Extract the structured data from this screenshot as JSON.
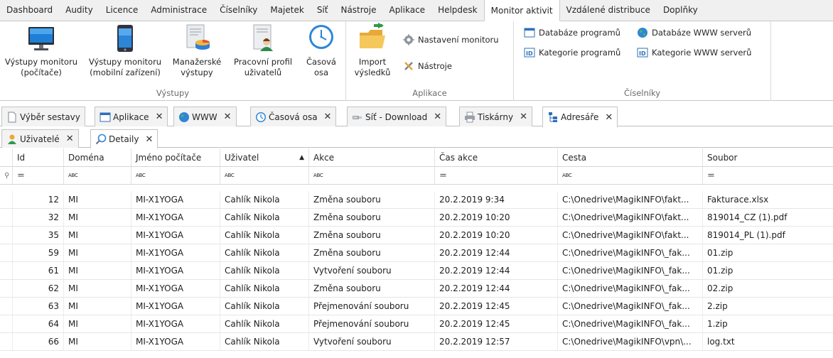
{
  "menu": [
    "Dashboard",
    "Audity",
    "Licence",
    "Administrace",
    "Číselníky",
    "Majetek",
    "Síť",
    "Nástroje",
    "Aplikace",
    "Helpdesk",
    "Monitor aktivit",
    "Vzdálené distribuce",
    "Doplňky"
  ],
  "menu_active": "Monitor aktivit",
  "ribbon": {
    "vystupy": {
      "title": "Výstupy",
      "btn1": [
        "Výstupy monitoru",
        "(počítače)"
      ],
      "btn2": [
        "Výstupy monitoru",
        "(mobilní zařízení)"
      ],
      "btn3": [
        "Manažerské",
        "výstupy"
      ],
      "btn4": [
        "Pracovní profil",
        "uživatelů"
      ],
      "btn5": [
        "Časová",
        "osa"
      ]
    },
    "aplikace": {
      "title": "Aplikace",
      "import": [
        "Import",
        "výsledků"
      ],
      "nastaveni": "Nastavení monitoru",
      "nastroje": "Nástroje"
    },
    "ciselniky": {
      "title": "Číselníky",
      "db_programu": "Databáze programů",
      "kat_programu": "Kategorie programů",
      "db_www": "Databáze WWW serverů",
      "kat_www": "Kategorie WWW serverů"
    }
  },
  "doc_tabs": [
    "Výběr sestavy",
    "Aplikace",
    "WWW",
    "Časová osa",
    "Síť - Download",
    "Tiskárny",
    "Adresáře"
  ],
  "doc_tab_active": "Adresáře",
  "sub_tabs": [
    "Uživatelé",
    "Detaily"
  ],
  "sub_tab_active": "Detaily",
  "grid": {
    "columns": [
      "Id",
      "Doména",
      "Jméno počítače",
      "Uživatel",
      "Akce",
      "Čas akce",
      "Cesta",
      "Soubor"
    ],
    "filter_eq": "=",
    "filter_abc": "ABC",
    "rows": [
      [
        "12",
        "MI",
        "MI-X1YOGA",
        "Cahlík Nikola",
        "Změna souboru",
        "20.2.2019 9:34",
        "C:\\Onedrive\\MagikINFO\\fakt...",
        "Fakturace.xlsx"
      ],
      [
        "32",
        "MI",
        "MI-X1YOGA",
        "Cahlík Nikola",
        "Změna souboru",
        "20.2.2019 10:20",
        "C:\\Onedrive\\MagikINFO\\fakt...",
        "819014_CZ (1).pdf"
      ],
      [
        "35",
        "MI",
        "MI-X1YOGA",
        "Cahlík Nikola",
        "Změna souboru",
        "20.2.2019 10:20",
        "C:\\Onedrive\\MagikINFO\\fakt...",
        "819014_PL (1).pdf"
      ],
      [
        "59",
        "MI",
        "MI-X1YOGA",
        "Cahlík Nikola",
        "Změna souboru",
        "20.2.2019 12:44",
        "C:\\Onedrive\\MagikINFO\\_fak...",
        "01.zip"
      ],
      [
        "61",
        "MI",
        "MI-X1YOGA",
        "Cahlík Nikola",
        "Vytvoření souboru",
        "20.2.2019 12:44",
        "C:\\Onedrive\\MagikINFO\\_fak...",
        "01.zip"
      ],
      [
        "62",
        "MI",
        "MI-X1YOGA",
        "Cahlík Nikola",
        "Změna souboru",
        "20.2.2019 12:44",
        "C:\\Onedrive\\MagikINFO\\_fak...",
        "02.zip"
      ],
      [
        "63",
        "MI",
        "MI-X1YOGA",
        "Cahlík Nikola",
        "Přejmenování souboru",
        "20.2.2019 12:45",
        "C:\\Onedrive\\MagikINFO\\_fak...",
        "2.zip"
      ],
      [
        "64",
        "MI",
        "MI-X1YOGA",
        "Cahlík Nikola",
        "Přejmenování souboru",
        "20.2.2019 12:45",
        "C:\\Onedrive\\MagikINFO\\_fak...",
        "1.zip"
      ],
      [
        "66",
        "MI",
        "MI-X1YOGA",
        "Cahlík Nikola",
        "Vytvoření souboru",
        "20.2.2019 12:57",
        "C:\\Onedrive\\MagikINFO\\vpn\\...",
        "log.txt"
      ]
    ]
  }
}
